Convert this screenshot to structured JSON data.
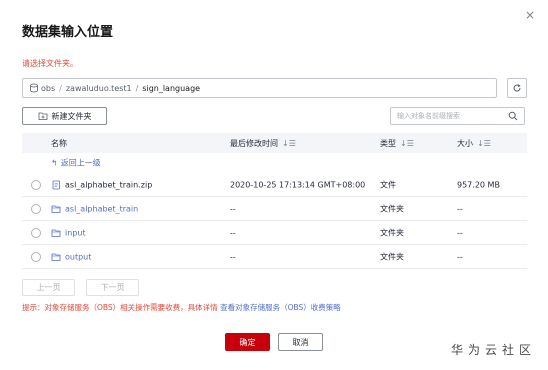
{
  "dialog": {
    "title": "数据集输入位置",
    "warning": "请选择文件夹。",
    "close_glyph": "×"
  },
  "path": {
    "root": "obs",
    "separator": "/",
    "segments": [
      "zawaluduo.test1"
    ],
    "current": "sign_language"
  },
  "toolbar": {
    "new_folder_label": "新建文件夹",
    "search_placeholder": "输入对象名前缀搜索"
  },
  "table": {
    "columns": {
      "name": "名称",
      "modified": "最后修改时间",
      "type": "类型",
      "size": "大小"
    },
    "sort_glyph": "↓☰",
    "back_label": "返回上一级",
    "back_glyph": "↰",
    "rows": [
      {
        "name": "asl_alphabet_train.zip",
        "modified": "2020-10-25 17:13:14 GMT+08:00",
        "type": "文件",
        "size": "957.20 MB",
        "kind": "file"
      },
      {
        "name": "asl_alphabet_train",
        "modified": "--",
        "type": "文件夹",
        "size": "--",
        "kind": "folder"
      },
      {
        "name": "input",
        "modified": "--",
        "type": "文件夹",
        "size": "--",
        "kind": "folder"
      },
      {
        "name": "output",
        "modified": "--",
        "type": "文件夹",
        "size": "--",
        "kind": "folder"
      }
    ]
  },
  "pagination": {
    "prev_label": "上一页",
    "next_label": "下一页"
  },
  "tip": {
    "text": "提示：对象存储服务（OBS）相关操作需要收费，具体详情",
    "link": "查看对象存储服务（OBS）收费策略"
  },
  "footer": {
    "ok_label": "确定",
    "cancel_label": "取消"
  },
  "watermark": "华为云社区",
  "colors": {
    "primary": "#c7000b",
    "link": "#526ecc",
    "warning": "#e5473a"
  },
  "icons": {
    "close": "close-icon",
    "database": "database-icon",
    "refresh": "refresh-icon",
    "new_folder": "new-folder-icon",
    "search": "search-icon",
    "file": "file-icon",
    "folder": "folder-icon",
    "back": "back-icon"
  }
}
